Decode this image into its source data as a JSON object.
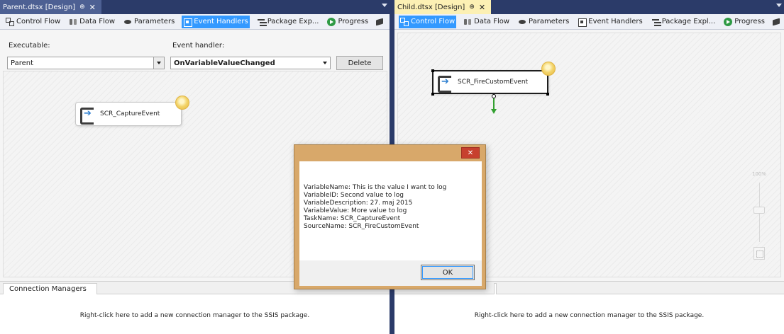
{
  "left": {
    "doc_tab": {
      "title": "Parent.dtsx [Design]",
      "pin": "⊕",
      "close": "✕"
    },
    "designer_tabs": [
      {
        "label": "Control Flow",
        "icon": "control-flow-icon"
      },
      {
        "label": "Data Flow",
        "icon": "data-flow-icon"
      },
      {
        "label": "Parameters",
        "icon": "parameters-icon"
      },
      {
        "label": "Event Handlers",
        "icon": "event-handlers-icon",
        "selected": true
      },
      {
        "label": "Package Exp...",
        "icon": "package-explorer-icon"
      },
      {
        "label": "Progress",
        "icon": "progress-icon"
      }
    ],
    "executable_label": "Executable:",
    "executable_value": "Parent",
    "event_handler_label": "Event handler:",
    "event_handler_value": "OnVariableValueChanged",
    "delete_label": "Delete",
    "task_name": "SCR_CaptureEvent",
    "connection_managers_tab": "Connection Managers",
    "cm_hint": "Right-click here to add a new connection manager to the SSIS package."
  },
  "right": {
    "doc_tab": {
      "title": "Child.dtsx [Design]",
      "pin": "⊕",
      "close": "✕"
    },
    "designer_tabs": [
      {
        "label": "Control Flow",
        "icon": "control-flow-icon",
        "selected": true
      },
      {
        "label": "Data Flow",
        "icon": "data-flow-icon"
      },
      {
        "label": "Parameters",
        "icon": "parameters-icon"
      },
      {
        "label": "Event Handlers",
        "icon": "event-handlers-icon"
      },
      {
        "label": "Package Expl...",
        "icon": "package-explorer-icon"
      },
      {
        "label": "Progress",
        "icon": "progress-icon"
      }
    ],
    "task_name": "SCR_FireCustomEvent",
    "zoom_label": "100%",
    "cm_hint": "Right-click here to add a new connection manager to the SSIS package."
  },
  "dialog": {
    "close": "✕",
    "lines": [
      "VariableName: This is the value I want to log",
      "VariableID: Second value to log",
      "VariableDescription: 27. maj 2015",
      "VariableValue: More value to log",
      "TaskName: SCR_CaptureEvent",
      "SourceName: SCR_FireCustomEvent"
    ],
    "ok_label": "OK"
  },
  "colors": {
    "tab_bar": "#2b3b69",
    "active_doc_tab": "#fcf0b4",
    "selected_designer_tab": "#3399ff",
    "dialog_frame": "#d8a86a",
    "dialog_close": "#c7402e",
    "connector": "#33a030"
  }
}
